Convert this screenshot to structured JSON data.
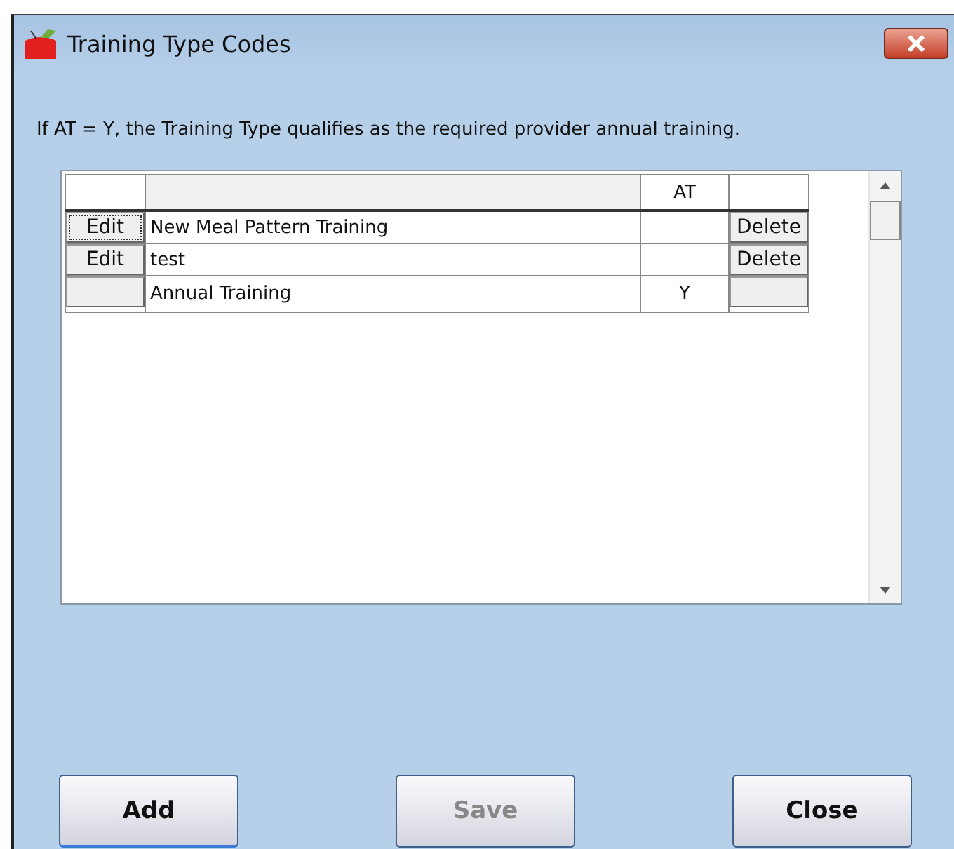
{
  "window": {
    "title": "Training Type Codes"
  },
  "note": "If AT = Y, the Training Type qualifies as the required provider annual training.",
  "table": {
    "columns": [
      "AT"
    ],
    "rows": [
      {
        "edit": {
          "label": "Edit",
          "focused": true
        },
        "name": "New Meal Pattern Training",
        "at": "",
        "delete": "Delete"
      },
      {
        "edit": {
          "label": "Edit",
          "focused": false
        },
        "name": "test",
        "at": "",
        "delete": "Delete"
      },
      {
        "edit": null,
        "name": "Annual Training",
        "at": "Y",
        "delete": null
      }
    ]
  },
  "buttons": [
    {
      "label": "Add",
      "disabled": false,
      "default": true
    },
    {
      "label": "Save",
      "disabled": true,
      "default": false
    },
    {
      "label": "Close",
      "disabled": false,
      "default": false
    }
  ]
}
